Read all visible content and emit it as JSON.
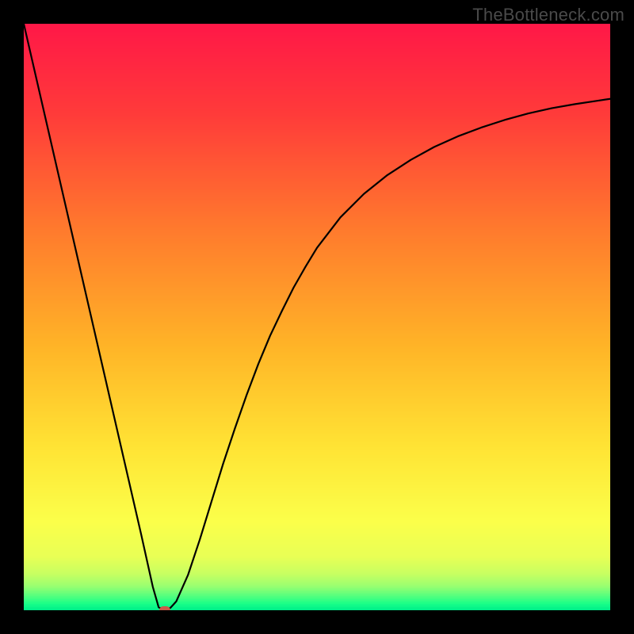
{
  "watermark": "TheBottleneck.com",
  "colors": {
    "frame": "#000000",
    "marker": "#cc5a4a",
    "curve": "#000000"
  },
  "chart_data": {
    "type": "line",
    "title": "",
    "xlabel": "",
    "ylabel": "",
    "xlim": [
      0,
      100
    ],
    "ylim": [
      0,
      100
    ],
    "x": [
      0,
      2,
      4,
      6,
      8,
      10,
      12,
      14,
      16,
      18,
      20,
      22,
      23,
      24,
      25,
      26,
      28,
      30,
      32,
      34,
      36,
      38,
      40,
      42,
      44,
      46,
      48,
      50,
      54,
      58,
      62,
      66,
      70,
      74,
      78,
      82,
      86,
      90,
      94,
      98,
      100
    ],
    "values": [
      100,
      91.3,
      82.6,
      73.9,
      65.2,
      56.5,
      47.8,
      39.1,
      30.4,
      21.7,
      13.0,
      4.0,
      0.5,
      0.0,
      0.4,
      1.5,
      6.0,
      12.0,
      18.5,
      25.0,
      31.0,
      36.7,
      42.0,
      46.8,
      51.0,
      55.0,
      58.5,
      61.8,
      67.0,
      71.0,
      74.2,
      76.8,
      79.0,
      80.8,
      82.3,
      83.6,
      84.7,
      85.6,
      86.3,
      86.9,
      87.2
    ],
    "marker": {
      "x": 24,
      "y": 0
    },
    "gradient_stops": [
      {
        "pos": 0.0,
        "color": "#ff1847"
      },
      {
        "pos": 0.15,
        "color": "#ff3a3a"
      },
      {
        "pos": 0.35,
        "color": "#ff7a2d"
      },
      {
        "pos": 0.55,
        "color": "#ffb427"
      },
      {
        "pos": 0.72,
        "color": "#ffe334"
      },
      {
        "pos": 0.85,
        "color": "#fbff4a"
      },
      {
        "pos": 0.91,
        "color": "#e8ff55"
      },
      {
        "pos": 0.94,
        "color": "#c6ff62"
      },
      {
        "pos": 0.96,
        "color": "#9aff70"
      },
      {
        "pos": 0.975,
        "color": "#5dff7d"
      },
      {
        "pos": 0.99,
        "color": "#1aff88"
      },
      {
        "pos": 1.0,
        "color": "#00f08a"
      }
    ]
  }
}
